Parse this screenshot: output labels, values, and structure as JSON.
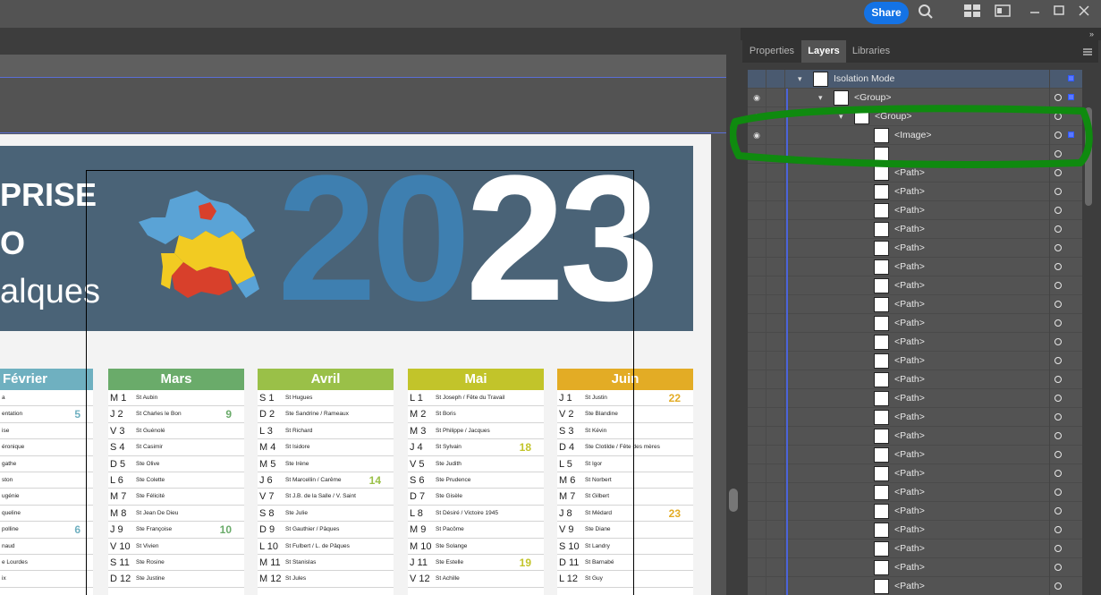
{
  "topbar": {
    "share_label": "Share"
  },
  "tabs": [
    {
      "label": "Properties",
      "active": false
    },
    {
      "label": "Layers",
      "active": true
    },
    {
      "label": "Libraries",
      "active": false
    }
  ],
  "layers": {
    "rows": [
      {
        "label": "Isolation Mode",
        "level": 0
      },
      {
        "label": "<Group>",
        "level": 1
      },
      {
        "label": "<Group>",
        "level": 2
      },
      {
        "label": "<Image>",
        "level": 3
      },
      {
        "label": "",
        "level": 3
      },
      {
        "label": "<Path>",
        "level": 3
      },
      {
        "label": "<Path>",
        "level": 3
      },
      {
        "label": "<Path>",
        "level": 3
      },
      {
        "label": "<Path>",
        "level": 3
      },
      {
        "label": "<Path>",
        "level": 3
      },
      {
        "label": "<Path>",
        "level": 3
      },
      {
        "label": "<Path>",
        "level": 3
      },
      {
        "label": "<Path>",
        "level": 3
      },
      {
        "label": "<Path>",
        "level": 3
      },
      {
        "label": "<Path>",
        "level": 3
      },
      {
        "label": "<Path>",
        "level": 3
      },
      {
        "label": "<Path>",
        "level": 3
      },
      {
        "label": "<Path>",
        "level": 3
      },
      {
        "label": "<Path>",
        "level": 3
      },
      {
        "label": "<Path>",
        "level": 3
      },
      {
        "label": "<Path>",
        "level": 3
      },
      {
        "label": "<Path>",
        "level": 3
      },
      {
        "label": "<Path>",
        "level": 3
      },
      {
        "label": "<Path>",
        "level": 3
      },
      {
        "label": "<Path>",
        "level": 3
      },
      {
        "label": "<Path>",
        "level": 3
      },
      {
        "label": "<Path>",
        "level": 3
      },
      {
        "label": "<Path>",
        "level": 3
      }
    ]
  },
  "calendar": {
    "banner": {
      "line1": "PRISE",
      "line2": "O",
      "line3": "alques",
      "year_a": "20",
      "year_b": "23"
    },
    "months": [
      {
        "name": "Février",
        "color": "#6fb0c0",
        "days": [
          {
            "d": "",
            "n": "a",
            "w": ""
          },
          {
            "d": "",
            "n": "entation",
            "w": "5"
          },
          {
            "d": "",
            "n": "ise",
            "w": ""
          },
          {
            "d": "",
            "n": "éronique",
            "w": ""
          },
          {
            "d": "",
            "n": "gathe",
            "w": ""
          },
          {
            "d": "",
            "n": "ston",
            "w": ""
          },
          {
            "d": "",
            "n": "ugénie",
            "w": ""
          },
          {
            "d": "",
            "n": "queline",
            "w": ""
          },
          {
            "d": "",
            "n": "polline",
            "w": "6"
          },
          {
            "d": "",
            "n": "naud",
            "w": ""
          },
          {
            "d": "",
            "n": "e Lourdes",
            "w": ""
          },
          {
            "d": "",
            "n": "ix",
            "w": ""
          }
        ]
      },
      {
        "name": "Mars",
        "color": "#6aab6a",
        "days": [
          {
            "d": "M 1",
            "n": "St Aubin",
            "w": ""
          },
          {
            "d": "J 2",
            "n": "St Charles le Bon",
            "w": "9"
          },
          {
            "d": "V 3",
            "n": "St Guénolé",
            "w": ""
          },
          {
            "d": "S 4",
            "n": "St Casimir",
            "w": ""
          },
          {
            "d": "D 5",
            "n": "Ste Olive",
            "w": ""
          },
          {
            "d": "L 6",
            "n": "Ste Colette",
            "w": ""
          },
          {
            "d": "M 7",
            "n": "Ste Félicité",
            "w": ""
          },
          {
            "d": "M 8",
            "n": "St Jean De Dieu",
            "w": ""
          },
          {
            "d": "J 9",
            "n": "Ste Françoise",
            "w": "10"
          },
          {
            "d": "V 10",
            "n": "St Vivien",
            "w": ""
          },
          {
            "d": "S 11",
            "n": "Ste Rosine",
            "w": ""
          },
          {
            "d": "D 12",
            "n": "Ste Justine",
            "w": ""
          }
        ]
      },
      {
        "name": "Avril",
        "color": "#9ac048",
        "days": [
          {
            "d": "S 1",
            "n": "St Hugues",
            "w": ""
          },
          {
            "d": "D 2",
            "n": "Ste Sandrine / Rameaux",
            "w": ""
          },
          {
            "d": "L 3",
            "n": "St Richard",
            "w": ""
          },
          {
            "d": "M 4",
            "n": "St Isidore",
            "w": ""
          },
          {
            "d": "M 5",
            "n": "Ste Irène",
            "w": ""
          },
          {
            "d": "J 6",
            "n": "St Marcellin / Carême",
            "w": "14"
          },
          {
            "d": "V 7",
            "n": "St J.B. de la Salle / V. Saint",
            "w": ""
          },
          {
            "d": "S 8",
            "n": "Ste Julie",
            "w": ""
          },
          {
            "d": "D 9",
            "n": "St Gauthier / Pâques",
            "w": ""
          },
          {
            "d": "L 10",
            "n": "St Fulbert / L. de Pâques",
            "w": ""
          },
          {
            "d": "M 11",
            "n": "St Stanislas",
            "w": ""
          },
          {
            "d": "M 12",
            "n": "St Jules",
            "w": ""
          }
        ]
      },
      {
        "name": "Mai",
        "color": "#c2c42a",
        "days": [
          {
            "d": "L 1",
            "n": "St Joseph / Fête du Travail",
            "w": ""
          },
          {
            "d": "M 2",
            "n": "St Boris",
            "w": ""
          },
          {
            "d": "M 3",
            "n": "St Philippe / Jacques",
            "w": ""
          },
          {
            "d": "J 4",
            "n": "St Sylvain",
            "w": "18"
          },
          {
            "d": "V 5",
            "n": "Ste Judith",
            "w": ""
          },
          {
            "d": "S 6",
            "n": "Ste Prudence",
            "w": ""
          },
          {
            "d": "D 7",
            "n": "Ste Gisèle",
            "w": ""
          },
          {
            "d": "L 8",
            "n": "St Désiré / Victoire 1945",
            "w": ""
          },
          {
            "d": "M 9",
            "n": "St Pacôme",
            "w": ""
          },
          {
            "d": "M 10",
            "n": "Ste Solange",
            "w": ""
          },
          {
            "d": "J 11",
            "n": "Ste Estelle",
            "w": "19"
          },
          {
            "d": "V 12",
            "n": "St Achille",
            "w": ""
          }
        ]
      },
      {
        "name": "Juin",
        "color": "#e3ac25",
        "days": [
          {
            "d": "J 1",
            "n": "St Justin",
            "w": "22"
          },
          {
            "d": "V 2",
            "n": "Ste Blandine",
            "w": ""
          },
          {
            "d": "S 3",
            "n": "St Kévin",
            "w": ""
          },
          {
            "d": "D 4",
            "n": "Ste Clotilde / Fête des mères",
            "w": ""
          },
          {
            "d": "L 5",
            "n": "St Igor",
            "w": ""
          },
          {
            "d": "M 6",
            "n": "St Norbert",
            "w": ""
          },
          {
            "d": "M 7",
            "n": "St Gilbert",
            "w": ""
          },
          {
            "d": "J 8",
            "n": "St Médard",
            "w": "23"
          },
          {
            "d": "V 9",
            "n": "Ste Diane",
            "w": ""
          },
          {
            "d": "S 10",
            "n": "St Landry",
            "w": ""
          },
          {
            "d": "D 11",
            "n": "St Barnabé",
            "w": ""
          },
          {
            "d": "L 12",
            "n": "St Guy",
            "w": ""
          }
        ]
      }
    ]
  }
}
